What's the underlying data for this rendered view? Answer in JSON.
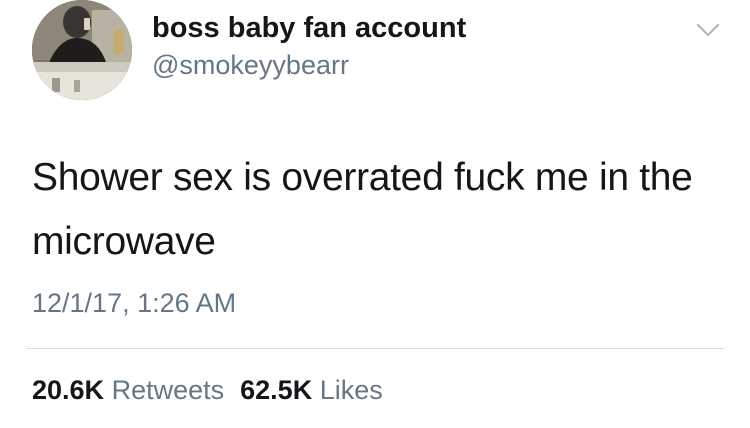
{
  "tweet": {
    "display_name": "boss baby fan account",
    "handle": "@smokeyybearr",
    "text": "Shower sex is overrated fuck me in the microwave",
    "timestamp": "12/1/17, 1:26 AM",
    "retweets_count": "20.6K",
    "retweets_label": "Retweets",
    "likes_count": "62.5K",
    "likes_label": "Likes"
  },
  "icons": {
    "menu": "chevron-down-icon",
    "avatar": "avatar"
  },
  "colors": {
    "primary_text": "#14171a",
    "secondary_text": "#657786",
    "divider": "#d8dde1",
    "background": "#ffffff"
  }
}
